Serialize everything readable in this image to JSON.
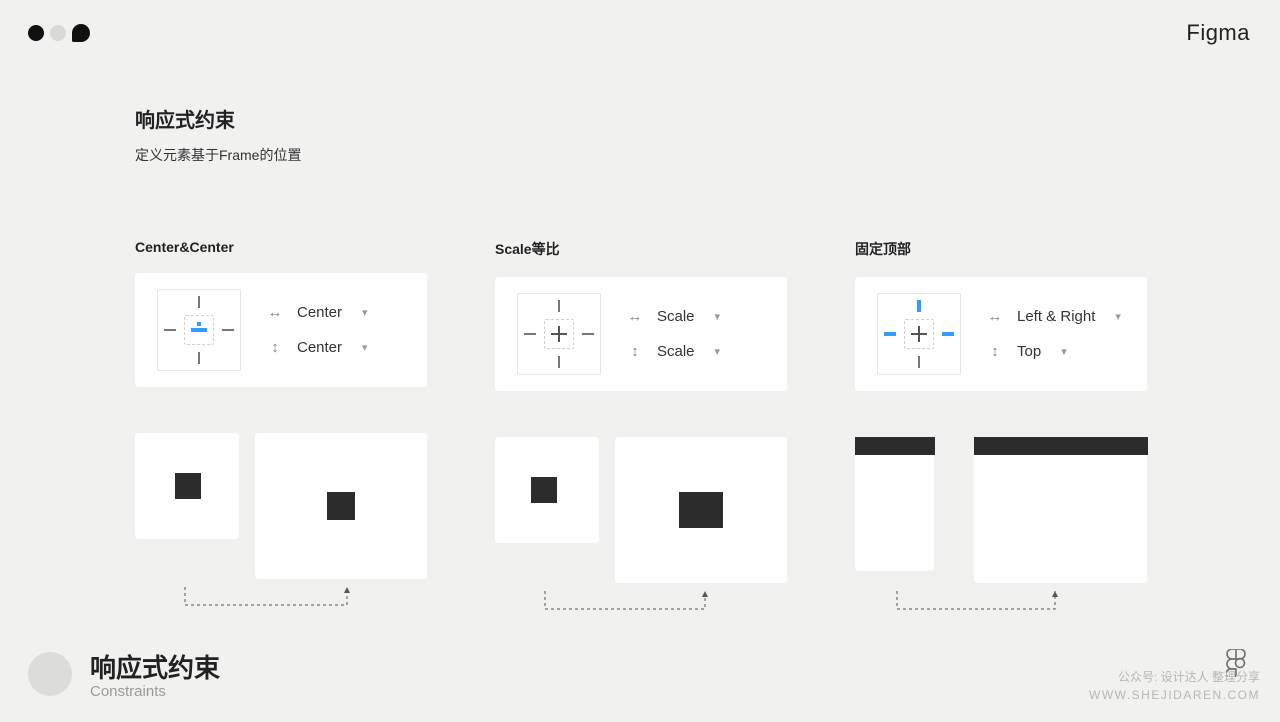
{
  "brand": "Figma",
  "page": {
    "title": "响应式约束",
    "subtitle": "定义元素基于Frame的位置"
  },
  "columns": [
    {
      "label": "Center&Center",
      "horizontal": "Center",
      "vertical": "Center",
      "glyph": "center-center"
    },
    {
      "label": "Scale等比",
      "horizontal": "Scale",
      "vertical": "Scale",
      "glyph": "scale"
    },
    {
      "label": "固定顶部",
      "horizontal": "Left & Right",
      "vertical": "Top",
      "glyph": "left-right-top"
    }
  ],
  "footer": {
    "title": "响应式约束",
    "subtitle": "Constraints"
  },
  "watermark": {
    "line1": "公众号: 设计达人 整理分享",
    "line2": "WWW.SHEJIDAREN.COM"
  }
}
